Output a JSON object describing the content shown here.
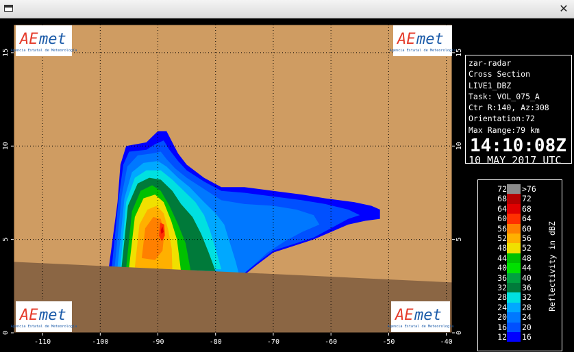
{
  "window": {
    "close_glyph": "✕"
  },
  "info": {
    "station": "zar-radar",
    "product": "Cross Section",
    "mode": "LIVE1_DBZ",
    "task": "Task: VOL_075_A",
    "center": "Ctr R:140, Az:308",
    "orientation": "Orientation:72",
    "max_range": "Max Range:79 km",
    "time": "14:10:08Z",
    "date": "10 MAY 2017 UTC"
  },
  "logo": {
    "name": "AEmet",
    "subtitle": "Agencia Estatal de Meteorología"
  },
  "legend": {
    "title": "Reflectivity in dBZ",
    "rows": [
      {
        "lo": "72",
        "hi": ">76",
        "color": "#8a8a8a"
      },
      {
        "lo": "68",
        "hi": "72",
        "color": "#b30000"
      },
      {
        "lo": "64",
        "hi": "68",
        "color": "#e00000"
      },
      {
        "lo": "60",
        "hi": "64",
        "color": "#ff3000"
      },
      {
        "lo": "56",
        "hi": "60",
        "color": "#ff8000"
      },
      {
        "lo": "52",
        "hi": "56",
        "color": "#ffb000"
      },
      {
        "lo": "48",
        "hi": "52",
        "color": "#f0e000"
      },
      {
        "lo": "44",
        "hi": "48",
        "color": "#00c000"
      },
      {
        "lo": "40",
        "hi": "44",
        "color": "#00e000"
      },
      {
        "lo": "36",
        "hi": "40",
        "color": "#00a040"
      },
      {
        "lo": "32",
        "hi": "36",
        "color": "#007a3a"
      },
      {
        "lo": "28",
        "hi": "32",
        "color": "#00e0e0"
      },
      {
        "lo": "24",
        "hi": "28",
        "color": "#00a8ff"
      },
      {
        "lo": "20",
        "hi": "24",
        "color": "#0078ff"
      },
      {
        "lo": "16",
        "hi": "20",
        "color": "#0050ff"
      },
      {
        "lo": "12",
        "hi": "16",
        "color": "#0000ff"
      }
    ]
  },
  "chart_data": {
    "type": "heatmap",
    "x_ticks": [
      "-110",
      "-100",
      "-90",
      "-80",
      "-70",
      "-60",
      "-50",
      "-40"
    ],
    "y_ticks": [
      "0",
      "5",
      "10",
      "15"
    ],
    "xlim": [
      -115,
      -39
    ],
    "ylim": [
      0,
      16.5
    ],
    "grid": true,
    "background_color": "#cf9c62",
    "terrain_color": "#8b6644",
    "terrain": [
      [
        -115,
        3.8
      ],
      [
        -39,
        2.7
      ]
    ],
    "echo_core_max_dbz": "60-64",
    "echo_x_range": [
      -98,
      -52
    ],
    "echo_top_km": 10.8
  }
}
